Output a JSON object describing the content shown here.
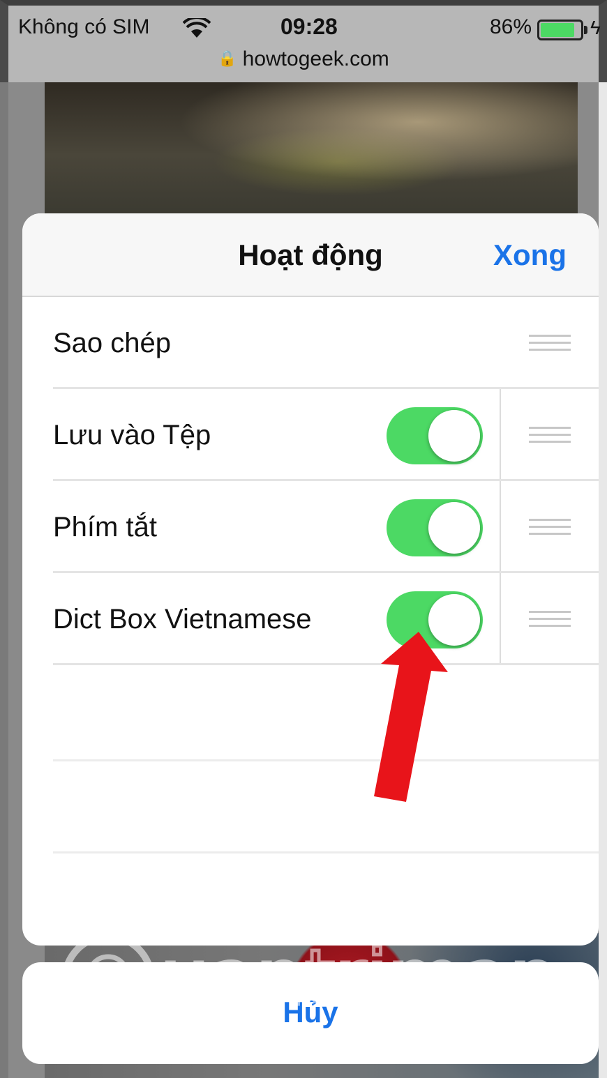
{
  "status_bar": {
    "carrier": "Không có SIM",
    "time": "09:28",
    "battery_percent": "86%",
    "battery_level": 0.86,
    "url": "howtogeek.com"
  },
  "action_sheet": {
    "title": "Hoạt động",
    "done_label": "Xong",
    "rows": [
      {
        "label": "Sao chép"
      },
      {
        "label": "Lưu vào Tệp",
        "enabled": true
      },
      {
        "label": "Phím tắt",
        "enabled": true
      },
      {
        "label": "Dict Box Vietnamese",
        "enabled": true
      }
    ]
  },
  "cancel_label": "Hủy",
  "watermark": "Quantrimang",
  "colors": {
    "accent": "#1a73e8",
    "toggle_on": "#4cd964",
    "arrow": "#e8141a"
  }
}
